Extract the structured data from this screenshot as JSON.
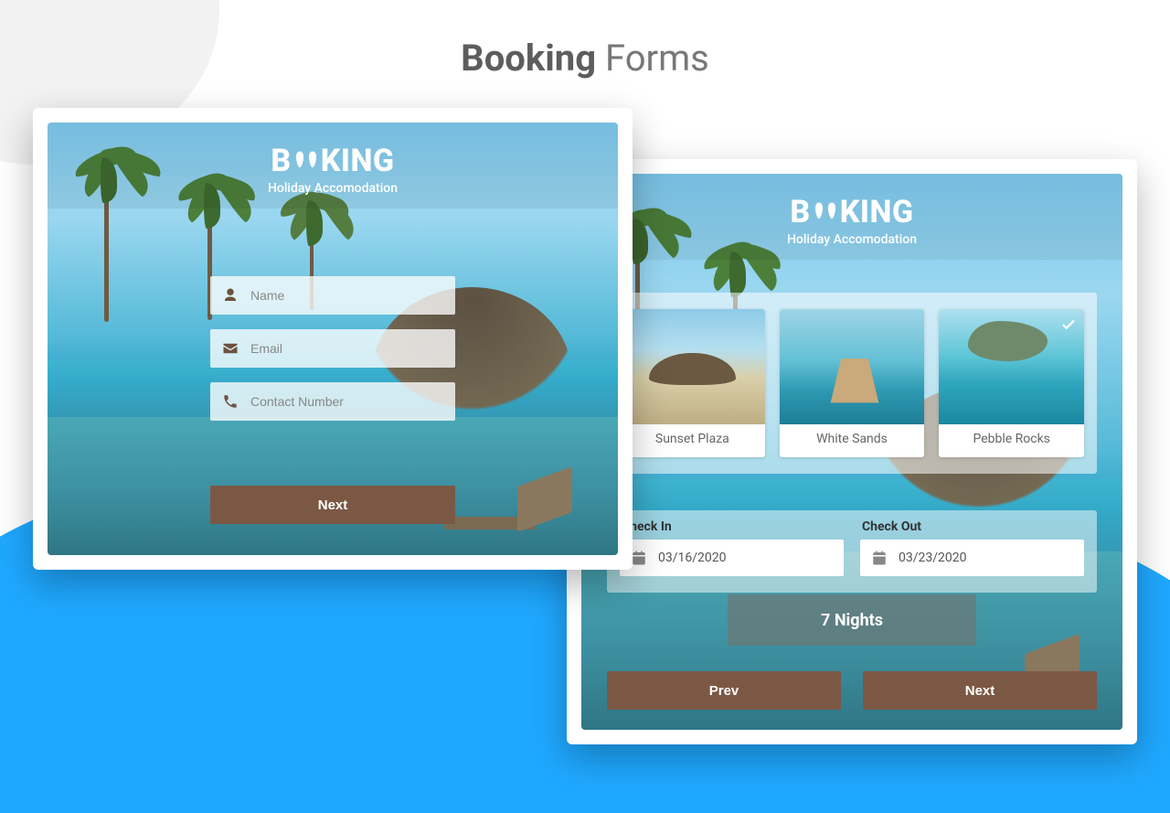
{
  "page": {
    "title_bold": "Booking",
    "title_rest": " Forms"
  },
  "brand": {
    "name": "BOOKING",
    "tagline": "Holiday Accomodation"
  },
  "form1": {
    "name_placeholder": "Name",
    "email_placeholder": "Email",
    "contact_placeholder": "Contact Number",
    "next_label": "Next"
  },
  "form2": {
    "locations": [
      {
        "label": "Sunset Plaza",
        "selected": false
      },
      {
        "label": "White Sands",
        "selected": false
      },
      {
        "label": "Pebble Rocks",
        "selected": true
      }
    ],
    "checkin_label": "Check In",
    "checkout_label": "Check Out",
    "checkin_value": "03/16/2020",
    "checkout_value": "03/23/2020",
    "nights_label": "7 Nights",
    "prev_label": "Prev",
    "next_label": "Next"
  },
  "colors": {
    "accent": "#7b5844",
    "sky": "#1fa8ff"
  }
}
